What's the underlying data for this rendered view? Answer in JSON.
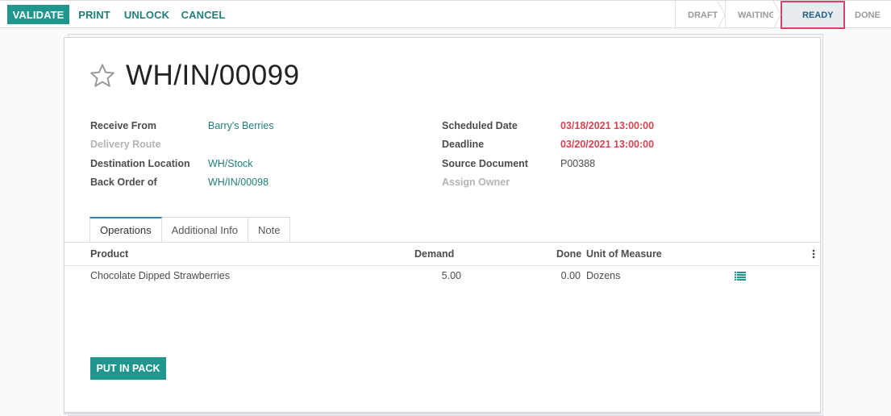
{
  "control_bar": {
    "buttons": [
      {
        "label": "VALIDATE",
        "style": "primary"
      },
      {
        "label": "PRINT",
        "style": "link"
      },
      {
        "label": "UNLOCK",
        "style": "link"
      },
      {
        "label": "CANCEL",
        "style": "link"
      }
    ]
  },
  "status_bar": {
    "stages": [
      {
        "label": "DRAFT",
        "active": false
      },
      {
        "label": "WAITING",
        "active": false
      },
      {
        "label": "READY",
        "active": true
      },
      {
        "label": "DONE",
        "active": false
      }
    ],
    "highlight_color": "#d9416b"
  },
  "record": {
    "title": "WH/IN/00099",
    "favorite_icon": "star-outline-icon",
    "left_fields": [
      {
        "label": "Receive From",
        "value": "Barry's Berries",
        "muted": false
      },
      {
        "label": "Delivery Route",
        "value": "",
        "muted": true
      },
      {
        "label": "Destination Location",
        "value": "WH/Stock",
        "muted": false
      },
      {
        "label": "Back Order of",
        "value": "WH/IN/00098",
        "muted": false
      }
    ],
    "right_fields": [
      {
        "label": "Scheduled Date",
        "value": "03/18/2021 13:00:00",
        "muted": false
      },
      {
        "label": "Deadline",
        "value": "03/20/2021 13:00:00",
        "muted": false
      },
      {
        "label": "Source Document",
        "value": "P00388",
        "muted": false
      },
      {
        "label": "Assign Owner",
        "value": "",
        "muted": true
      }
    ]
  },
  "tabs": [
    {
      "label": "Operations",
      "active": true
    },
    {
      "label": "Additional Info",
      "active": false
    },
    {
      "label": "Note",
      "active": false
    }
  ],
  "operations_table": {
    "columns": [
      "Product",
      "Demand",
      "Done",
      "Unit of Measure"
    ],
    "rows": [
      {
        "product": "Chocolate Dipped Strawberries",
        "demand": "5.00",
        "done": "0.00",
        "uom": "Dozens"
      }
    ]
  },
  "actions": {
    "put_in_pack_label": "PUT IN PACK"
  },
  "colors": {
    "primary": "#1f978f",
    "link": "#1f7f7a",
    "alert": "#d9434f"
  }
}
